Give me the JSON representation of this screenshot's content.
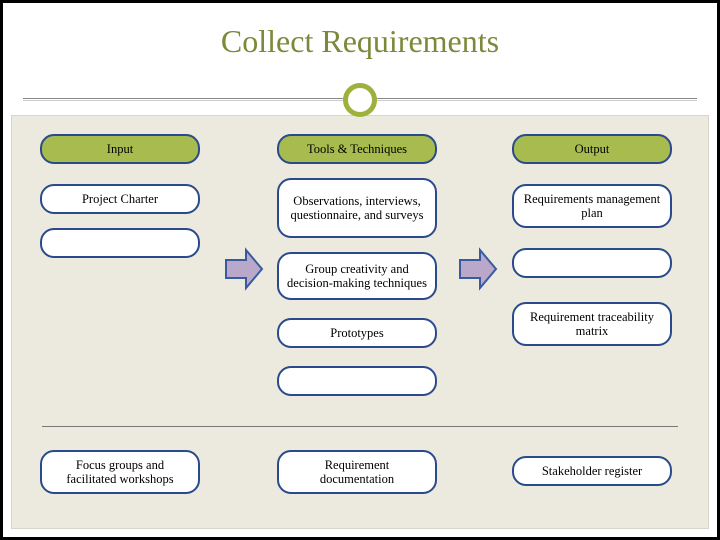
{
  "title": "Collect Requirements",
  "columns": {
    "input": {
      "header": "Input",
      "items": [
        "Project Charter"
      ],
      "blanks": 1,
      "footer": "Focus groups and facilitated workshops"
    },
    "tools": {
      "header": "Tools & Techniques",
      "items": [
        "Observations, interviews, questionnaire, and surveys",
        "Group creativity and decision-making techniques",
        "Prototypes"
      ],
      "blanks": 1,
      "footer": "Requirement documentation"
    },
    "output": {
      "header": "Output",
      "items": [
        "Requirements management plan",
        "",
        "Requirement traceability matrix"
      ],
      "blanks": 0,
      "footer": "Stakeholder register"
    }
  },
  "colors": {
    "accent": "#9cb23c",
    "pill_border": "#2a4a8c",
    "arrow_fill": "#b9a8c9",
    "arrow_stroke": "#3a5aa0"
  },
  "chart_data": {
    "type": "table",
    "title": "Collect Requirements — Inputs, Tools & Techniques, Outputs",
    "columns": [
      "Input",
      "Tools & Techniques",
      "Output"
    ],
    "rows": [
      [
        "Project Charter",
        "Observations, interviews, questionnaire, and surveys",
        "Requirements management plan"
      ],
      [
        "",
        "Group creativity and decision-making techniques",
        ""
      ],
      [
        "",
        "Prototypes",
        "Requirement traceability matrix"
      ],
      [
        "Focus groups and facilitated workshops",
        "Requirement documentation",
        "Stakeholder register"
      ]
    ]
  }
}
